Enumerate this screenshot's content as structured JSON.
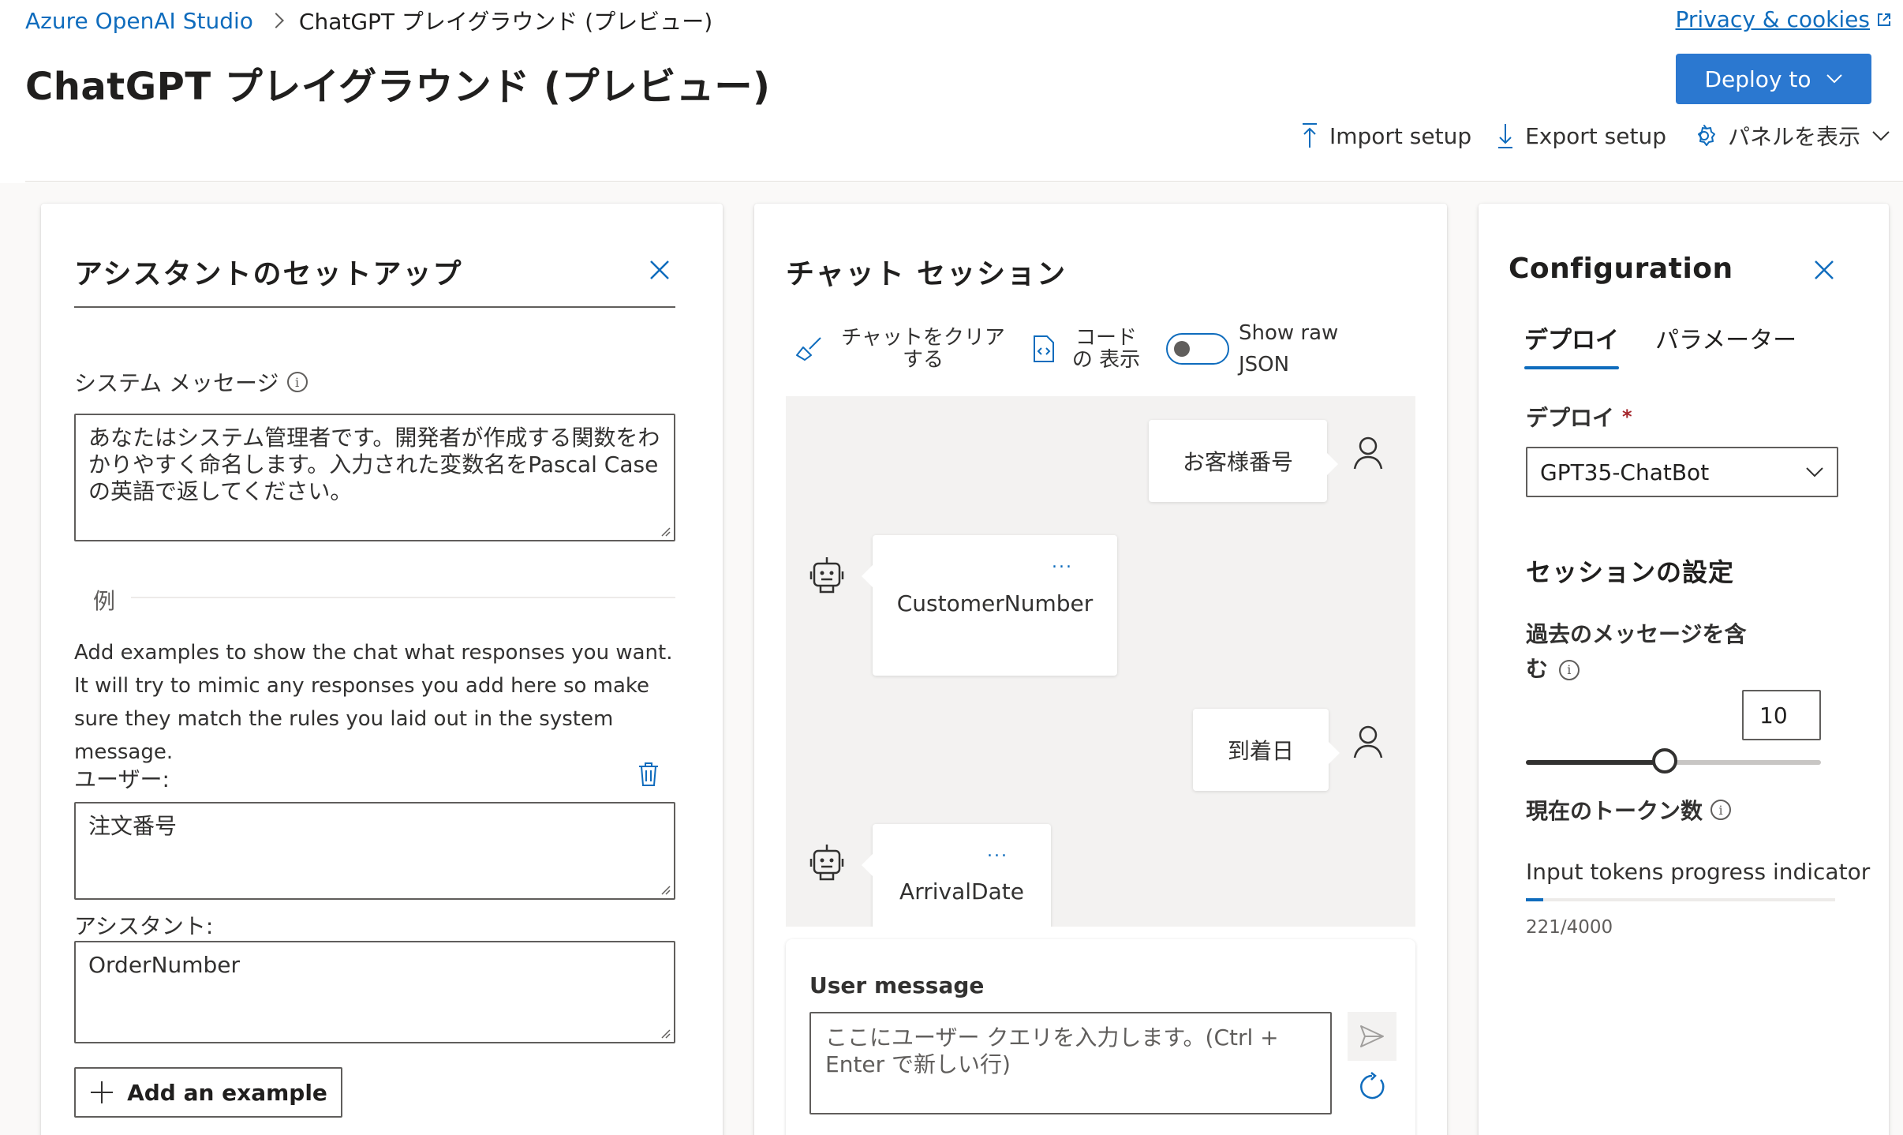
{
  "breadcrumb": {
    "root": "Azure OpenAI Studio",
    "current": "ChatGPT プレイグラウンド (プレビュー)"
  },
  "page_title": "ChatGPT プレイグラウンド (プレビュー)",
  "privacy_link": "Privacy & cookies",
  "deploy_button": "Deploy to",
  "toolbar": {
    "import": "Import setup",
    "export": "Export setup",
    "show_panels": "パネルを表示"
  },
  "assistant_setup": {
    "title": "アシスタントのセットアップ",
    "system_message_label": "システム メッセージ",
    "system_message": "あなたはシステム管理者です。開発者が作成する関数をわかりやすく命名します。入力された変数名をPascal Caseの英語で返してください。",
    "examples_label": "例",
    "examples_help": "Add examples to show the chat what responses you want. It will try to mimic any responses you add here so make sure they match the rules you laid out in the system message.",
    "user_label": "ユーザー:",
    "user_value": "注文番号",
    "assistant_label": "アシスタント:",
    "assistant_value": "OrderNumber",
    "add_example": "Add an example"
  },
  "chat": {
    "title": "チャット セッション",
    "clear_chat": "チャットをクリア する",
    "view_code": "コードの 表示",
    "show_raw_json": "Show raw JSON",
    "messages": [
      {
        "role": "user",
        "text": "お客様番号"
      },
      {
        "role": "assistant",
        "text": "CustomerNumber"
      },
      {
        "role": "user",
        "text": "到着日"
      },
      {
        "role": "assistant",
        "text": "ArrivalDate"
      }
    ],
    "more_dots": "...",
    "user_message_label": "User message",
    "user_message_placeholder": "ここにユーザー クエリを入力します。(Ctrl + Enter で新しい行)"
  },
  "configuration": {
    "title": "Configuration",
    "tabs": [
      "デプロイ",
      "パラメーター"
    ],
    "deployment_label": "デプロイ",
    "required_mark": "*",
    "deployment_value": "GPT35-ChatBot",
    "session_settings_title": "セッションの設定",
    "past_messages_label": "過去のメッセージを含む",
    "past_messages_value": "10",
    "past_messages_slider_fraction": 0.47,
    "token_count_label": "現在のトークン数",
    "input_tokens_label": "Input tokens progress indicator",
    "token_usage": "221/4000",
    "token_fraction": 0.055
  },
  "colors": {
    "accent": "#0f6cbd",
    "deploy_button": "#2b78d0"
  }
}
